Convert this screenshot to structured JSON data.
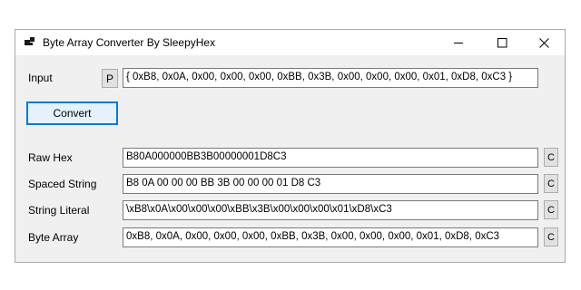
{
  "window": {
    "title": "Byte Array Converter By SleepyHex"
  },
  "input": {
    "label": "Input",
    "paste_button": "P",
    "value": "{ 0xB8, 0x0A, 0x00, 0x00, 0x00, 0xBB, 0x3B, 0x00, 0x00, 0x00, 0x01, 0xD8, 0xC3 }"
  },
  "convert_button": "Convert",
  "outputs": [
    {
      "label": "Raw Hex",
      "value": "B80A000000BB3B00000001D8C3",
      "copy": "C"
    },
    {
      "label": "Spaced String",
      "value": "B8 0A 00 00 00 BB 3B 00 00 00 01 D8 C3",
      "copy": "C"
    },
    {
      "label": "String Literal",
      "value": "\\xB8\\x0A\\x00\\x00\\x00\\xBB\\x3B\\x00\\x00\\x00\\x01\\xD8\\xC3",
      "copy": "C"
    },
    {
      "label": "Byte Array",
      "value": "0xB8, 0x0A, 0x00, 0x00, 0x00, 0xBB, 0x3B, 0x00, 0x00, 0x00, 0x01, 0xD8, 0xC3",
      "copy": "C"
    }
  ],
  "icons": [
    "app-icon",
    "minimize-icon",
    "maximize-icon",
    "close-icon"
  ]
}
